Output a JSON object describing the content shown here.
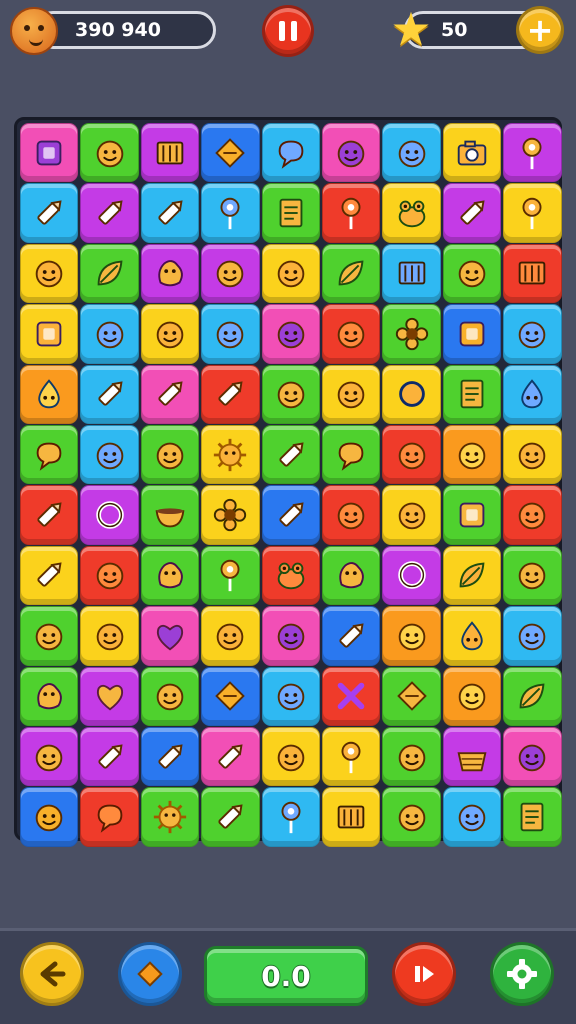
{
  "hud": {
    "score": "390 940",
    "stars": "50",
    "score_icon": "fox-face-icon",
    "stars_icon": "star-icon",
    "plus_label": "+"
  },
  "board": {
    "columns": 9,
    "rows": 12,
    "tiles": [
      [
        "pink:box",
        "green:face",
        "purple:cage",
        "blue:diamond",
        "cyan:bubble",
        "pink:face",
        "cyan:face",
        "yellow:camera",
        "purple:lollipop"
      ],
      [
        "cyan:pencil",
        "purple:pencil",
        "cyan:pencil",
        "cyan:lollipop",
        "green:notepad",
        "red:lollipop",
        "yellow:frog",
        "purple:pencil",
        "yellow:lollipop"
      ],
      [
        "yellow:face",
        "green:leaf",
        "purple:blob",
        "purple:face",
        "yellow:face",
        "green:leaf",
        "cyan:cage",
        "green:face",
        "red:cage"
      ],
      [
        "yellow:box",
        "cyan:face",
        "yellow:face",
        "cyan:face",
        "pink:face",
        "red:face",
        "green:flower",
        "blue:box",
        "cyan:face"
      ],
      [
        "orange:drop",
        "cyan:pencil",
        "pink:pencil",
        "red:pencil",
        "green:face",
        "yellow:face",
        "yellow:circle",
        "green:notepad",
        "cyan:drop"
      ],
      [
        "green:bubble",
        "cyan:face",
        "green:face",
        "yellow:sun",
        "green:pencil",
        "green:bubble",
        "red:face",
        "orange:face",
        "yellow:face"
      ],
      [
        "red:pencil",
        "purple:ring",
        "green:bowl",
        "yellow:flower",
        "blue:pencil",
        "red:face",
        "yellow:face",
        "green:box",
        "red:face"
      ],
      [
        "yellow:pencil",
        "red:face",
        "green:blob",
        "green:lollipop",
        "red:frog",
        "green:blob",
        "purple:ring",
        "yellow:leaf",
        "green:face"
      ],
      [
        "green:face",
        "yellow:face",
        "pink:heart",
        "yellow:face",
        "pink:face",
        "blue:pencil",
        "orange:face",
        "yellow:drop",
        "cyan:face"
      ],
      [
        "green:blob",
        "purple:heart",
        "green:face",
        "blue:diamond",
        "cyan:face",
        "red:cross",
        "green:diamond",
        "orange:face",
        "green:leaf"
      ],
      [
        "purple:face",
        "purple:pencil",
        "blue:pencil",
        "pink:pencil",
        "yellow:face",
        "yellow:lollipop",
        "green:face",
        "purple:basket",
        "pink:face"
      ],
      [
        "blue:face",
        "red:bubble",
        "green:sun",
        "green:pencil",
        "cyan:lollipop",
        "yellow:cage",
        "green:face",
        "cyan:face",
        "green:notepad"
      ]
    ]
  },
  "tile_colors": {
    "pink": "#f24fb6",
    "green": "#4fd12e",
    "purple": "#c43be6",
    "blue": "#2a78f0",
    "cyan": "#2fb9f2",
    "yellow": "#fbd21c",
    "orange": "#fa9a1e",
    "red": "#ef3b2a"
  },
  "bottom_bar": {
    "counter": "0.0",
    "back_icon": "arrow-left-icon",
    "gem_icon": "diamond-icon",
    "skip_icon": "skip-icon",
    "settings_icon": "gear-icon"
  }
}
